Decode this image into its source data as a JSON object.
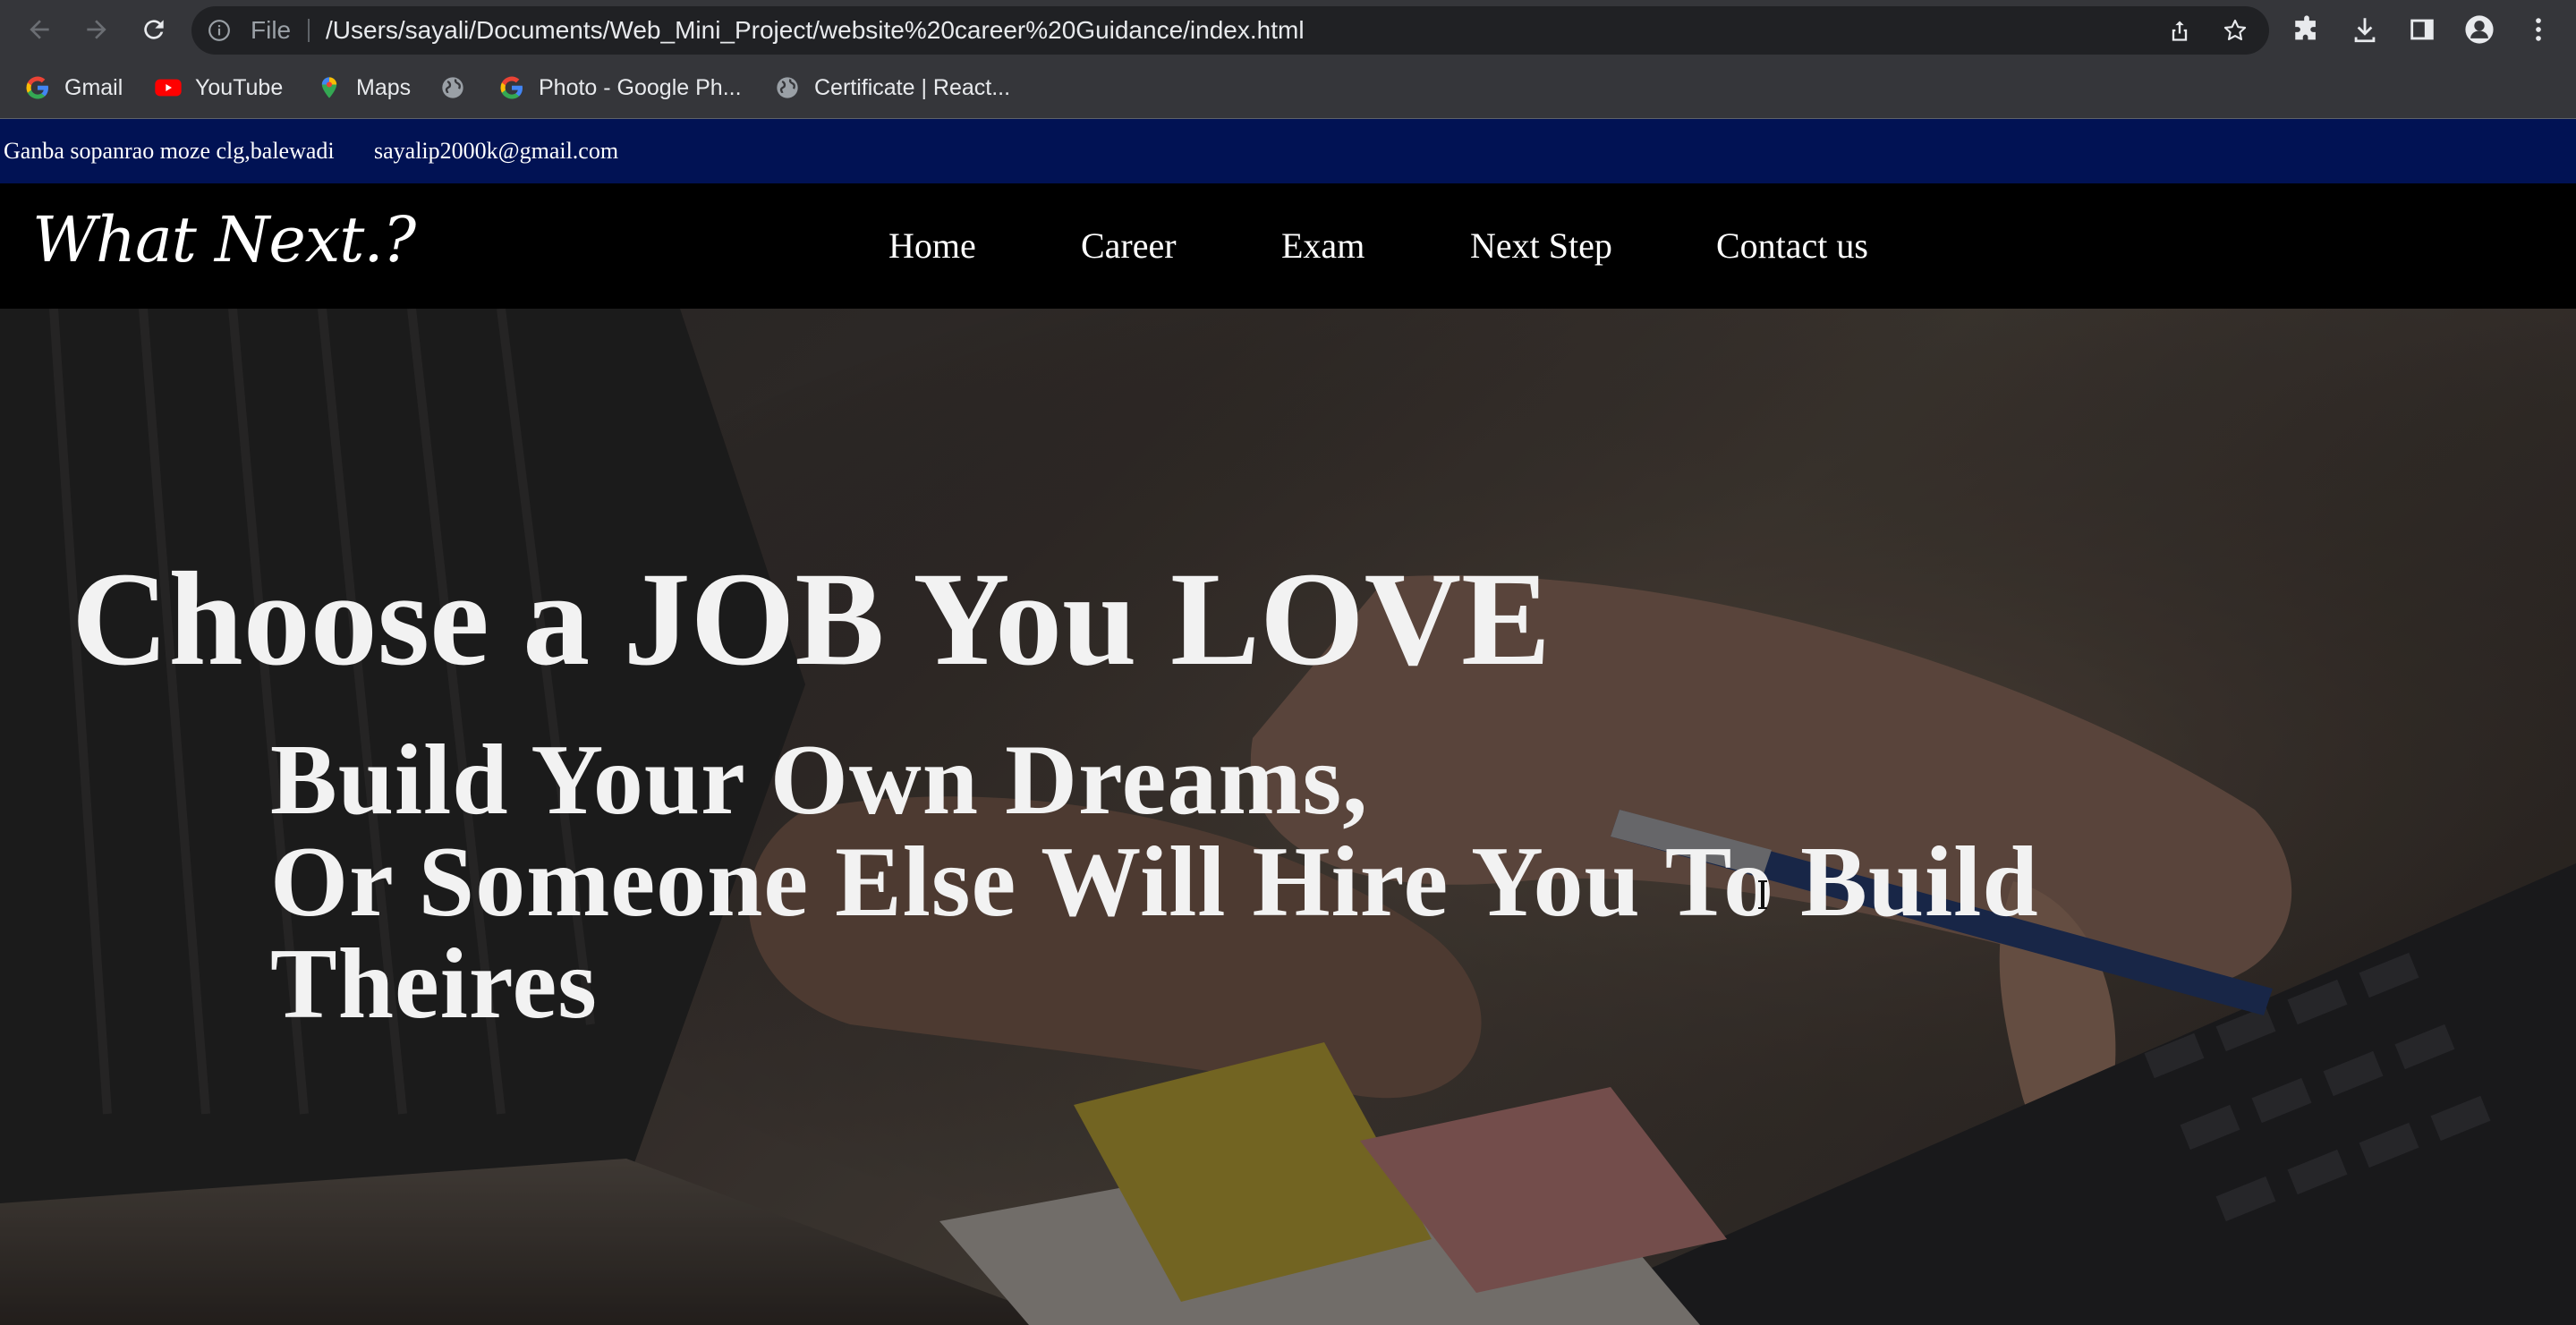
{
  "browser": {
    "omnibox": {
      "scheme_label": "File",
      "url": "/Users/sayali/Documents/Web_Mini_Project/website%20career%20Guidance/index.html"
    },
    "bookmarks": [
      {
        "label": "Gmail",
        "icon": "google-icon"
      },
      {
        "label": "YouTube",
        "icon": "youtube-icon"
      },
      {
        "label": "Maps",
        "icon": "maps-pin-icon"
      },
      {
        "label": "",
        "icon": "globe-icon"
      },
      {
        "label": "Photo - Google Ph...",
        "icon": "google-icon"
      },
      {
        "label": "Certificate | React...",
        "icon": "globe-icon"
      }
    ]
  },
  "site": {
    "topbar": {
      "address": "Ganba sopanrao moze clg,balewadi",
      "email": "sayalip2000k@gmail.com"
    },
    "logo": "What Next.?",
    "nav": [
      "Home",
      "Career",
      "Exam",
      "Next Step",
      "Contact us"
    ],
    "hero": {
      "heading": "Choose a JOB You LOVE",
      "subheading_lines": [
        "Build Your Own Dreams,",
        "Or Someone Else Will Hire You To Build",
        "Theires"
      ]
    }
  },
  "colors": {
    "chrome_bg": "#35363a",
    "omnibox_bg": "#202124",
    "topbar_bg": "#011254",
    "navbar_bg": "#000000",
    "hero_text": "#f2f2f2"
  }
}
